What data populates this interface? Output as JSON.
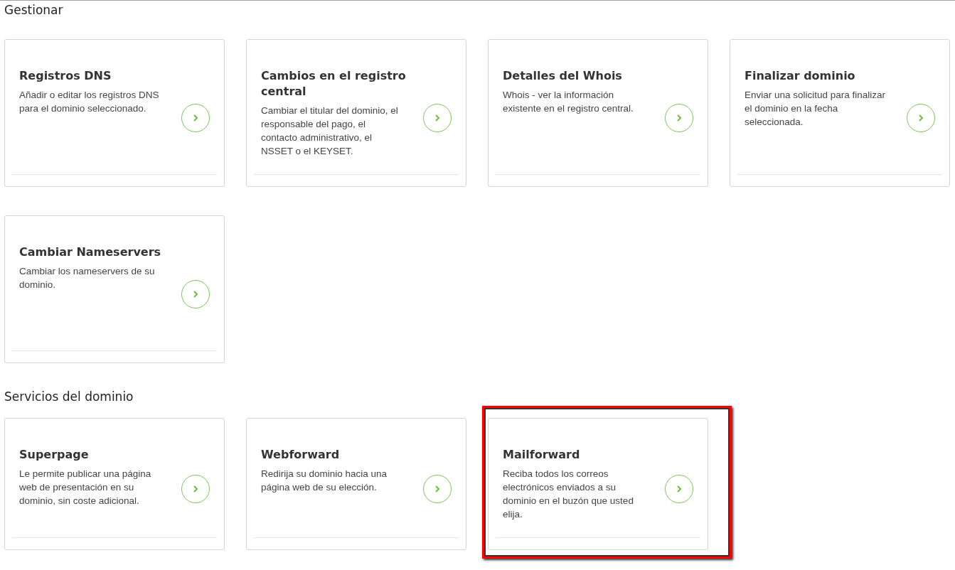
{
  "sections": [
    {
      "title": "Gestionar",
      "cards": [
        {
          "title": "Registros DNS",
          "description": "Añadir o editar los registros DNS para el dominio seleccionado.",
          "highlighted": false
        },
        {
          "title": "Cambios en el registro central",
          "description": "Cambiar el titular del dominio, el responsable del pago, el contacto administrativo, el NSSET o el KEYSET.",
          "highlighted": false
        },
        {
          "title": "Detalles del Whois",
          "description": "Whois - ver la información existente en el registro central.",
          "highlighted": false
        },
        {
          "title": "Finalizar dominio",
          "description": "Enviar una solicitud para finalizar el dominio en la fecha seleccionada.",
          "highlighted": false
        },
        {
          "title": "Cambiar Nameservers",
          "description": "Cambiar los nameservers de su dominio.",
          "highlighted": false
        }
      ]
    },
    {
      "title": "Servicios del dominio",
      "cards": [
        {
          "title": "Superpage",
          "description": "Le permite publicar una página web de presentación en su dominio, sin coste adicional.",
          "highlighted": false
        },
        {
          "title": "Webforward",
          "description": "Redirija su dominio hacia una página web de su elección.",
          "highlighted": false
        },
        {
          "title": "Mailforward",
          "description": "Reciba todos los correos electrónicos enviados a su dominio en el buzón que usted elija.",
          "highlighted": true
        }
      ]
    }
  ]
}
